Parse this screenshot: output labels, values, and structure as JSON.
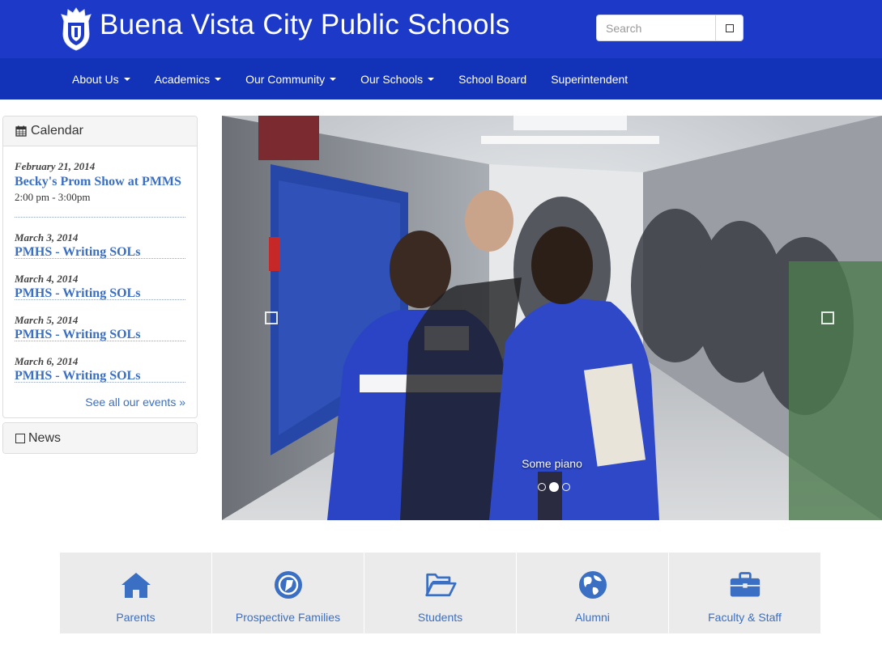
{
  "site": {
    "title": "Buena Vista City Public Schools"
  },
  "search": {
    "placeholder": "Search",
    "button_icon": "square-icon"
  },
  "nav": {
    "items": [
      {
        "label": "About Us",
        "dropdown": true
      },
      {
        "label": "Academics",
        "dropdown": true
      },
      {
        "label": "Our Community",
        "dropdown": true
      },
      {
        "label": "Our Schools",
        "dropdown": true
      },
      {
        "label": "School Board",
        "dropdown": false
      },
      {
        "label": "Superintendent",
        "dropdown": false
      }
    ]
  },
  "calendar": {
    "heading": "Calendar",
    "events": [
      {
        "date": "February 21, 2014",
        "title": "Becky's Prom Show at PMMS",
        "time": "2:00 pm - 3:00pm"
      },
      {
        "date": "March 3, 2014",
        "title": "PMHS - Writing SOLs",
        "time": ""
      },
      {
        "date": "March 4, 2014",
        "title": "PMHS - Writing SOLs",
        "time": ""
      },
      {
        "date": "March 5, 2014",
        "title": "PMHS - Writing SOLs",
        "time": ""
      },
      {
        "date": "March 6, 2014",
        "title": "PMHS - Writing SOLs",
        "time": ""
      }
    ],
    "see_all": "See all our events »"
  },
  "news": {
    "heading": "News"
  },
  "carousel": {
    "caption": "Some piano",
    "slide_count": 3,
    "active_slide": 2
  },
  "tiles": [
    {
      "label": "Parents",
      "icon": "home-icon"
    },
    {
      "label": "Prospective Families",
      "icon": "compass-icon"
    },
    {
      "label": "Students",
      "icon": "folder-open-icon"
    },
    {
      "label": "Alumni",
      "icon": "globe-icon"
    },
    {
      "label": "Faculty & Staff",
      "icon": "briefcase-icon"
    }
  ],
  "colors": {
    "header": "#1d39c8",
    "nav": "#1233b8",
    "link": "#3a6fc4",
    "tile_bg": "#ebebeb"
  }
}
